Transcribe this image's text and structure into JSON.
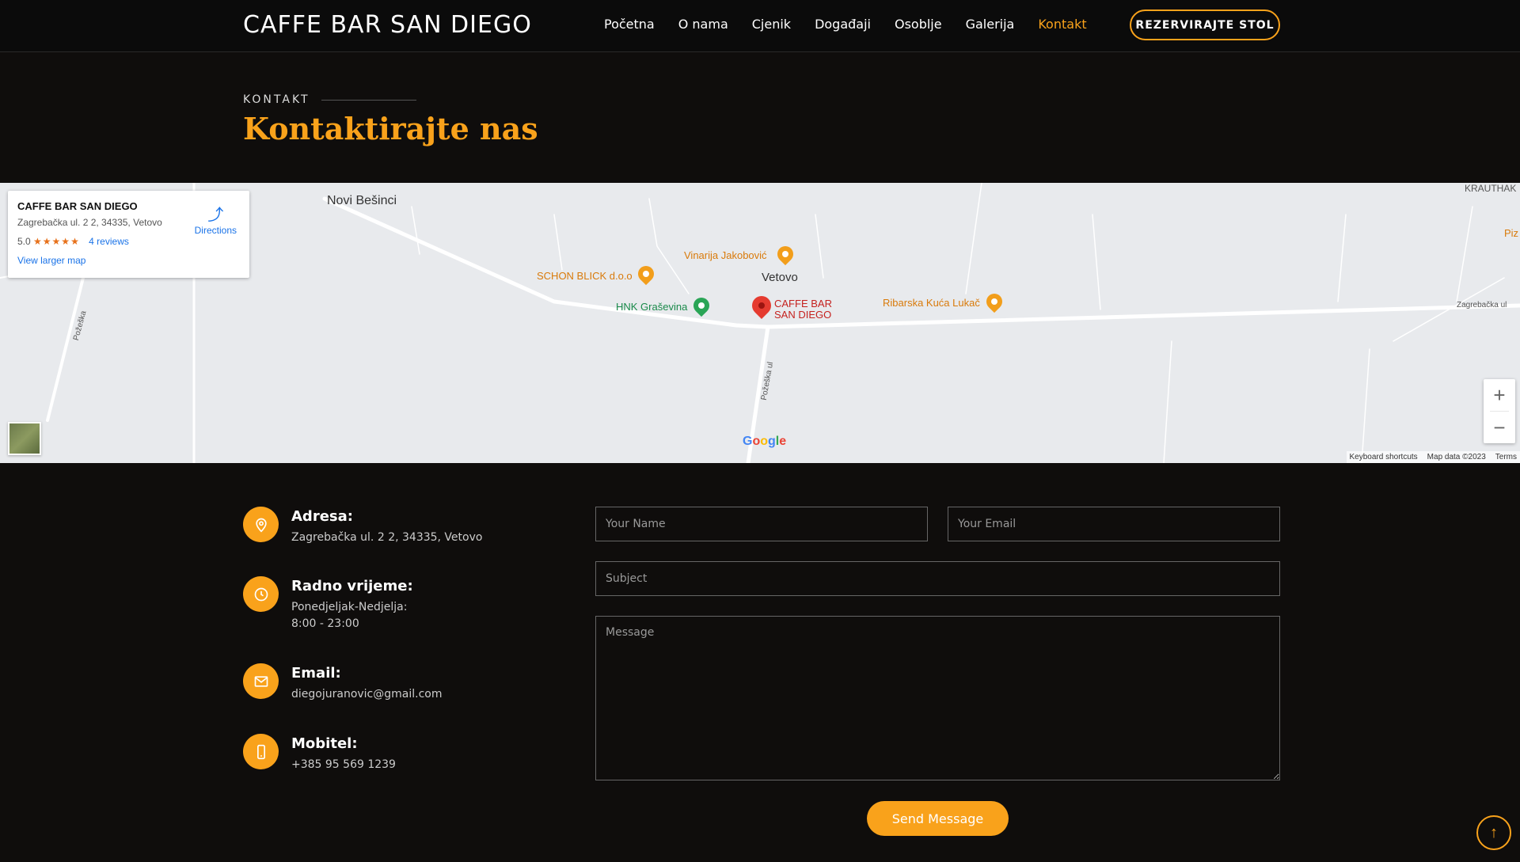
{
  "header": {
    "logo": "CAFFE BAR SAN DIEGO",
    "nav": [
      "Početna",
      "O nama",
      "Cjenik",
      "Događaji",
      "Osoblje",
      "Galerija",
      "Kontakt"
    ],
    "reserve_label": "REZERVIRAJTE STOL"
  },
  "section": {
    "label": "KONTAKT",
    "title": "Kontaktirajte nas"
  },
  "map": {
    "card": {
      "name": "CAFFE BAR SAN DIEGO",
      "address": "Zagrebačka ul. 2 2, 34335, Vetovo",
      "rating": "5.0",
      "stars": "★★★★★",
      "reviews": "4 reviews",
      "directions": "Directions",
      "larger_map": "View larger map"
    },
    "labels": {
      "novi_besinci": "Novi Bešinci",
      "vetovo": "Vetovo",
      "vinarija": "Vinarija Jakobović",
      "schon": "SCHON BLICK d.o.o",
      "hnk": "HNK Graševina",
      "cafe_1": "CAFFE BAR",
      "cafe_2": "SAN DIEGO",
      "ribarska": "Ribarska Kuća Lukač",
      "zagrebacka": "Zagrebačka ul",
      "pozeska_1": "Požeška",
      "pozeska_2": "Požeška ul",
      "krauthak": "KRAUTHAK",
      "piz": "Piz"
    },
    "footer": [
      "Keyboard shortcuts",
      "Map data ©2023",
      "Terms"
    ],
    "google": "Google"
  },
  "contact": {
    "address_title": "Adresa:",
    "address_text": "Zagrebačka ul. 2 2, 34335, Vetovo",
    "hours_title": "Radno vrijeme:",
    "hours_line1": "Ponedjeljak-Nedjelja:",
    "hours_line2": "8:00 - 23:00",
    "email_title": "Email:",
    "email_text": "diegojuranovic@gmail.com",
    "phone_title": "Mobitel:",
    "phone_text": "+385 95 569 1239"
  },
  "form": {
    "name_placeholder": "Your Name",
    "email_placeholder": "Your Email",
    "subject_placeholder": "Subject",
    "message_placeholder": "Message",
    "send_label": "Send Message"
  },
  "colors": {
    "accent": "#f9a21b",
    "background": "#0f0d0c"
  }
}
